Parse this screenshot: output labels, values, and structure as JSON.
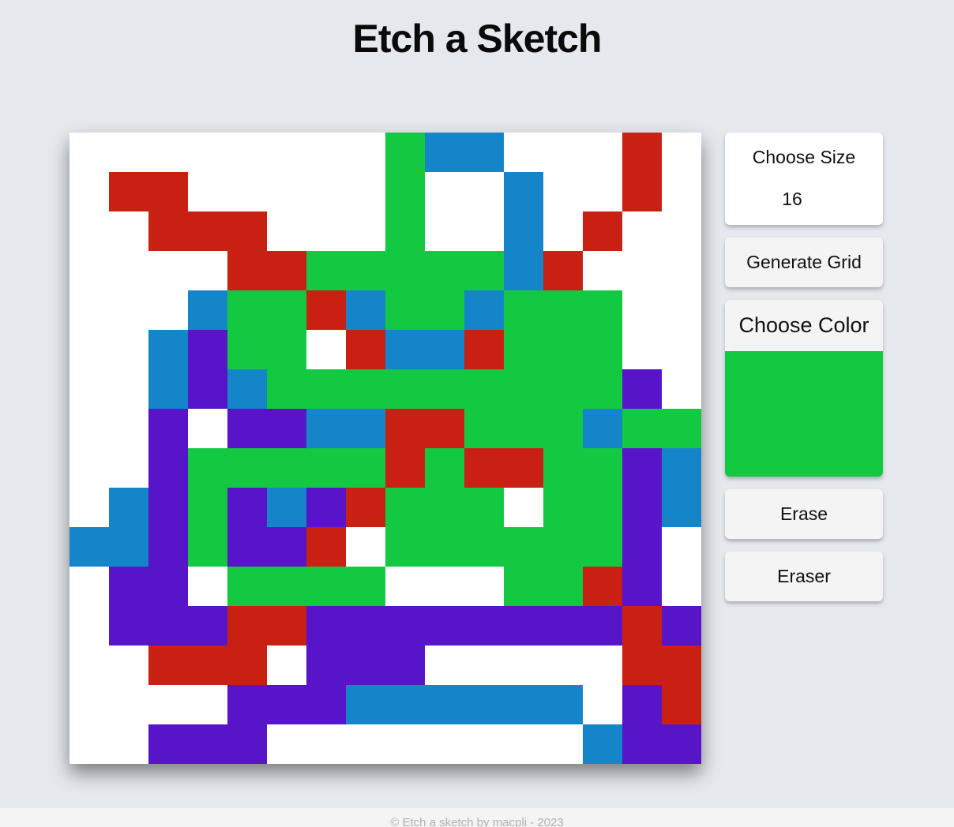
{
  "title": "Etch a Sketch",
  "controls": {
    "size_label": "Choose Size",
    "size_value": "16",
    "generate_label": "Generate Grid",
    "color_label": "Choose Color",
    "selected_color": "#14c942",
    "erase_label": "Erase",
    "eraser_label": "Eraser"
  },
  "grid": {
    "size": 16,
    "palette": {
      "W": "#ffffff",
      "R": "#c92014",
      "G": "#14c942",
      "B": "#1485c9",
      "P": "#5814c9"
    },
    "rows": [
      "WWWWWWWWGBBWWWRW",
      "WRRWWWWWGWWBWWRW",
      "WWRRRWWWGWWBWRWW",
      "WWWWRRGGGGGBRWWW",
      "WWWBGGRBGGBGGGWW",
      "WWBPGGWRBBRGGGWW",
      "WWBPBGGGGGGGGGPW",
      "WWPWPPBBRRGGGBGG",
      "WWPGGGGGRGRRGGPB",
      "WBPGPBPRGGGWGGPB",
      "BBPGPPRWGGGGGGPW",
      "WPPWGGGGWWWGGRPW",
      "WPPPRRPPPPPPPPRP",
      "WWRRRWPPPWWWWWRR",
      "WWWWPPPBBBBBBWPR",
      "WWPPPWWWWWWWWBPP"
    ]
  },
  "footer": "© Etch a sketch by macpli - 2023"
}
